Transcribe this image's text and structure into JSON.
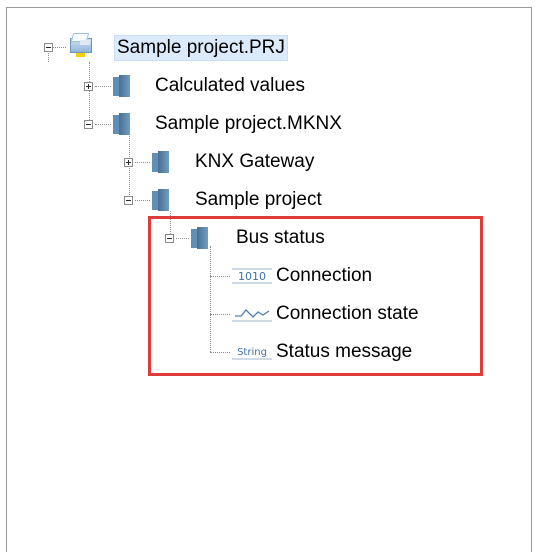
{
  "tree": {
    "root": {
      "label": "Sample project.PRJ",
      "icon": "project-file-icon"
    },
    "calculated_values": {
      "label": "Calculated values",
      "icon": "folder-icon"
    },
    "mknx": {
      "label": "Sample project.MKNX",
      "icon": "folder-icon"
    },
    "knx_gateway": {
      "label": "KNX Gateway",
      "icon": "folder-icon"
    },
    "sample_project": {
      "label": "Sample project",
      "icon": "folder-icon"
    },
    "bus_status": {
      "label": "Bus status",
      "icon": "folder-icon"
    },
    "connection": {
      "label": "Connection",
      "icon": "binary-datapoint-icon",
      "icon_text": "1010"
    },
    "connection_state": {
      "label": "Connection state",
      "icon": "analog-wave-icon"
    },
    "status_message": {
      "label": "Status message",
      "icon": "string-datapoint-icon",
      "icon_text": "String"
    }
  },
  "colors": {
    "highlight": "#df3b3b",
    "folder": "#5f8fb6",
    "selection": "#dcebfb"
  }
}
